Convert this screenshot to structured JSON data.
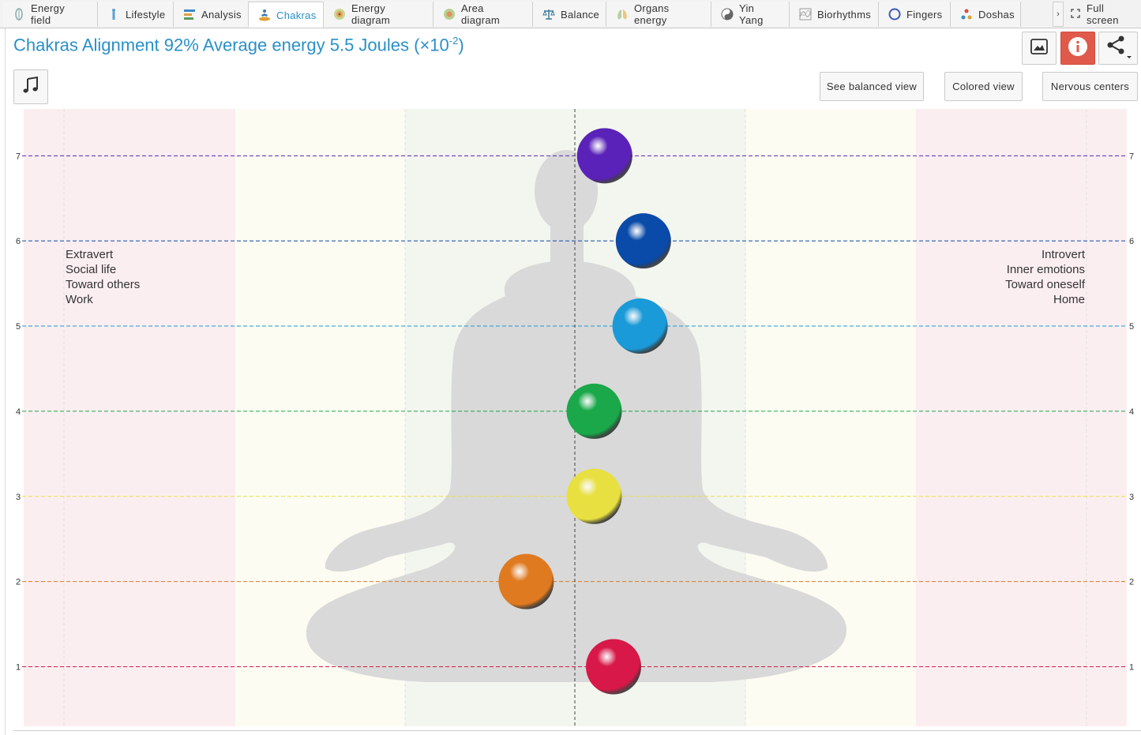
{
  "tabs": [
    {
      "label": "Energy field",
      "icon": "energy-field-icon",
      "active": false
    },
    {
      "label": "Lifestyle",
      "icon": "lifestyle-icon",
      "active": false
    },
    {
      "label": "Analysis",
      "icon": "analysis-icon",
      "active": false
    },
    {
      "label": "Chakras",
      "icon": "chakras-icon",
      "active": true
    },
    {
      "label": "Energy diagram",
      "icon": "energy-diagram-icon",
      "active": false
    },
    {
      "label": "Area diagram",
      "icon": "area-diagram-icon",
      "active": false
    },
    {
      "label": "Balance",
      "icon": "balance-icon",
      "active": false
    },
    {
      "label": "Organs energy",
      "icon": "organs-energy-icon",
      "active": false
    },
    {
      "label": "Yin Yang",
      "icon": "yin-yang-icon",
      "active": false
    },
    {
      "label": "Biorhythms",
      "icon": "biorhythms-icon",
      "active": false
    },
    {
      "label": "Fingers",
      "icon": "fingers-icon",
      "active": false
    },
    {
      "label": "Doshas",
      "icon": "doshas-icon",
      "active": false
    }
  ],
  "tab_scroll_label": "›",
  "fullscreen_label": "Full screen",
  "title": {
    "main": "Chakras Alignment 92% Average energy 5.5 Joules (×10",
    "exponent": "-2",
    "close": ")"
  },
  "buttons": {
    "see_balanced": "See balanced view",
    "colored": "Colored view",
    "nervous": "Nervous centers"
  },
  "left_text": [
    "Extravert",
    "Social life",
    "Toward others",
    "Work"
  ],
  "right_text": [
    "Introvert",
    "Inner emotions",
    "Toward oneself",
    "Home"
  ],
  "colors": {
    "accent": "#2a90c8",
    "info_red": "#e05a4c",
    "zone_outer": "#fbeef1",
    "zone_middle": "#fcfcf3",
    "zone_center": "#f3f5ef",
    "silhouette": "#d9d9d9"
  },
  "chart_data": {
    "type": "scatter",
    "y_ticks": [
      1,
      2,
      3,
      4,
      5,
      6,
      7
    ],
    "ylim": [
      0.3,
      7.55
    ],
    "xlim": [
      -1,
      1
    ],
    "center_x": 0,
    "series": [
      {
        "level": 7,
        "x": 0.054,
        "color": "#5a22b8"
      },
      {
        "level": 6,
        "x": 0.124,
        "color": "#0a4aa8"
      },
      {
        "level": 5,
        "x": 0.118,
        "color": "#1a9ad8"
      },
      {
        "level": 4,
        "x": 0.035,
        "color": "#1aa84a"
      },
      {
        "level": 3,
        "x": 0.035,
        "color": "#e8e040"
      },
      {
        "level": 2,
        "x": -0.088,
        "color": "#e07a20"
      },
      {
        "level": 1,
        "x": 0.07,
        "color": "#d81848"
      }
    ]
  }
}
